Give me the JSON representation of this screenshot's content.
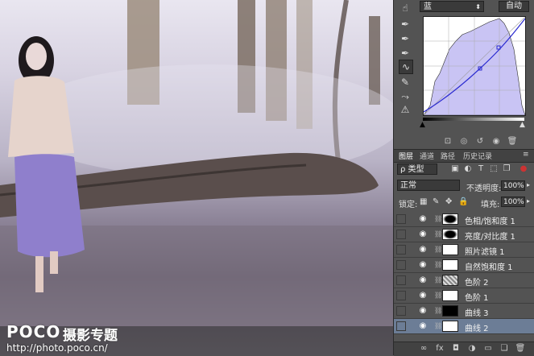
{
  "canvas": {
    "watermark_logo": "POCO",
    "watermark_sub": "摄影专题",
    "watermark_url": "http://photo.poco.cn/"
  },
  "curves": {
    "channel": "蓝",
    "auto_label": "自动",
    "tools": [
      "target-adjust-icon",
      "eyedropper-black-icon",
      "eyedropper-gray-icon",
      "eyedropper-white-icon",
      "curve-point-icon",
      "pencil-icon",
      "smooth-icon",
      "warning-icon"
    ],
    "bottom_icons": [
      "clip-icon",
      "visibility-icon",
      "reset-icon",
      "eye-icon",
      "trash-icon"
    ]
  },
  "layers_panel": {
    "tabs": [
      "图层",
      "通道",
      "路径",
      "历史记录"
    ],
    "filter_label": "ρ 类型",
    "blend_mode": "正常",
    "opacity_label": "不透明度:",
    "opacity_value": "100%",
    "lock_label": "锁定:",
    "fill_label": "填充:",
    "fill_value": "100%",
    "layers": [
      {
        "name": "色相/饱和度 1",
        "visible": true,
        "active": false,
        "mask": "black-center"
      },
      {
        "name": "亮度/对比度 1",
        "visible": true,
        "active": false,
        "mask": "black-center"
      },
      {
        "name": "照片滤镜 1",
        "visible": true,
        "active": false,
        "mask": "white"
      },
      {
        "name": "自然饱和度 1",
        "visible": true,
        "active": false,
        "mask": "white"
      },
      {
        "name": "色阶 2",
        "visible": true,
        "active": false,
        "mask": "gray-speckle"
      },
      {
        "name": "色阶 1",
        "visible": true,
        "active": false,
        "mask": "white"
      },
      {
        "name": "曲线 3",
        "visible": true,
        "active": false,
        "mask": "black-figure"
      },
      {
        "name": "曲线 2",
        "visible": true,
        "active": true,
        "mask": "white"
      }
    ]
  },
  "colors": {
    "panel_bg": "#535353",
    "selected_layer": "#6c7d96",
    "curve_fill": "#c9c4f4",
    "curve_line": "#2a2ad0"
  }
}
